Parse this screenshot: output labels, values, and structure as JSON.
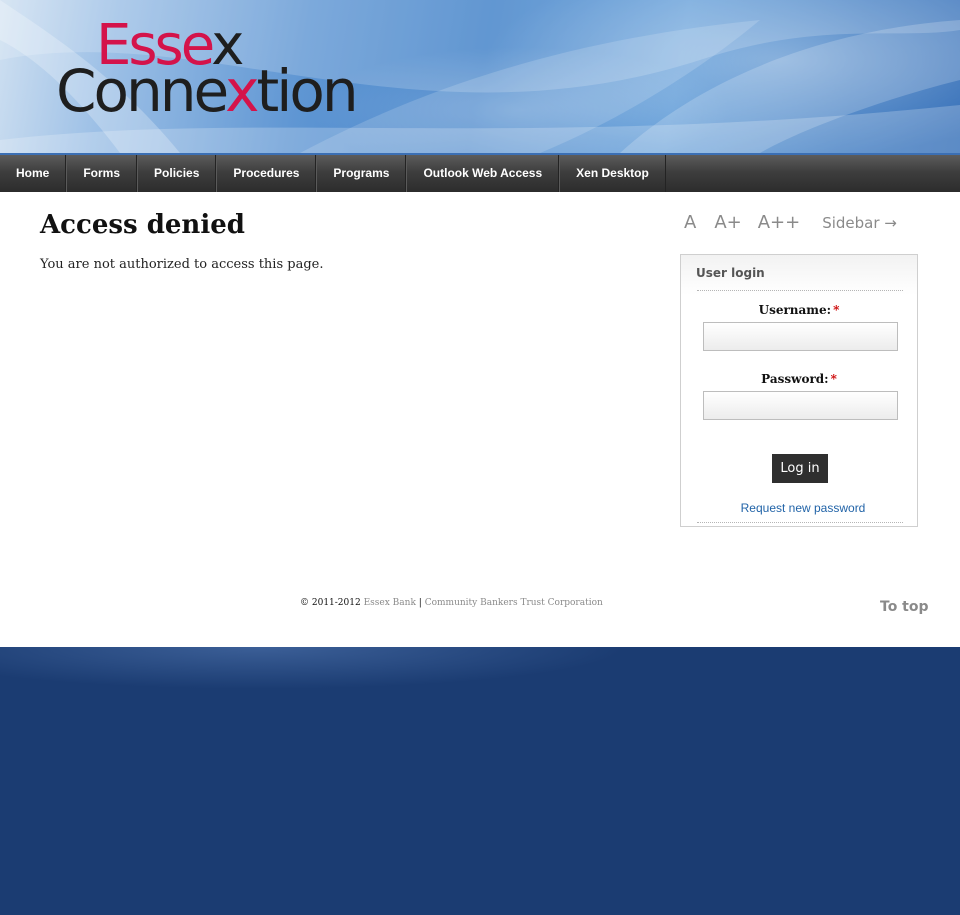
{
  "site": {
    "logo_line1": "Essex",
    "logo_line2": "Connextion",
    "logo_accent_color": "#d4134a"
  },
  "nav": {
    "items": [
      {
        "label": "Home"
      },
      {
        "label": "Forms"
      },
      {
        "label": "Policies"
      },
      {
        "label": "Procedures"
      },
      {
        "label": "Programs"
      },
      {
        "label": "Outlook Web Access"
      },
      {
        "label": "Xen Desktop"
      }
    ]
  },
  "main": {
    "title": "Access denied",
    "message": "You are not authorized to access this page."
  },
  "font_controls": {
    "small": "A",
    "medium": "A+",
    "large": "A++",
    "sidebar": "Sidebar →"
  },
  "login": {
    "title": "User login",
    "username_label": "Username:",
    "password_label": "Password:",
    "required_marker": "*",
    "username_value": "",
    "password_value": "",
    "button_label": "Log in",
    "request_link": "Request new password"
  },
  "footer": {
    "copyright": "© 2011-2012",
    "link1": "Essex Bank",
    "separator": "|",
    "link2": "Community Bankers Trust Corporation",
    "to_top": "To top"
  },
  "colors": {
    "nav_bg": "#3e3e3e",
    "link_blue": "#2264a8",
    "page_bg_blue": "#1b3c72",
    "required_red": "#cc0000"
  }
}
